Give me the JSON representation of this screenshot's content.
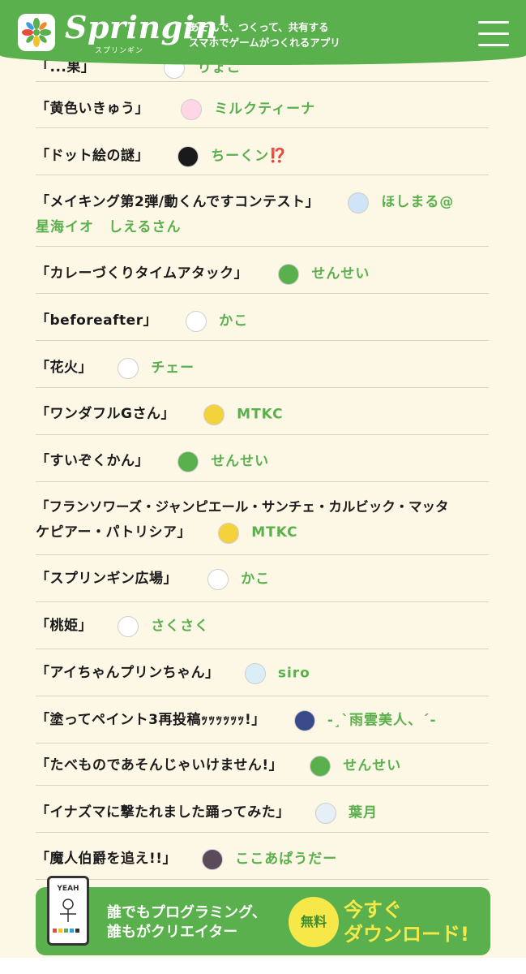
{
  "header": {
    "brand": "Springin'",
    "brand_kana": "スプリンギン",
    "tagline_1": "あそんで、つくって、共有する",
    "tagline_2": "スマホでゲームがつくれるアプリ"
  },
  "partial_row": {
    "title": "「...果」",
    "author": "りょこ"
  },
  "rows": [
    {
      "title": "「黄色いきゅう」",
      "author": "ミルクティーナ"
    },
    {
      "title": "「ドット絵の謎」",
      "author": "ちーくン",
      "suffix": "⁉️"
    },
    {
      "title": "「メイキング第2弾/動くんですコンテスト」",
      "author": "ほしまる@",
      "author_2": "星海イオ　しえるさん"
    },
    {
      "title": "「カレーづくりタイムアタック」",
      "author": "せんせい"
    },
    {
      "title": "「beforeafter」",
      "author": "かこ"
    },
    {
      "title": "「花火」",
      "author": "チェー"
    },
    {
      "title": "「ワンダフルGさん」",
      "author": "MTKC"
    },
    {
      "title": "「すいぞくかん」",
      "author": "せんせい"
    },
    {
      "title": "「フランソワーズ・ジャンピエール・サンチェ・カルビック・マッタ",
      "title_2": "ケピアー・パトリシア」",
      "author": "MTKC"
    },
    {
      "title": "「スプリンギン広場」",
      "author": "かこ"
    },
    {
      "title": "「桃姫」",
      "author": "さくさく"
    },
    {
      "title": "「アイちゃんプリンちゃん」",
      "author": "siro"
    },
    {
      "title": "「塗ってペイント3再投稿ｯｯｯｯｯｯ!」",
      "author": "-¸`雨雲美人、´-"
    },
    {
      "title": "「たべものであそんじゃいけません!」",
      "author": "せんせい"
    },
    {
      "title": "「イナズマに撃たれました踊ってみた」",
      "author": "葉月"
    },
    {
      "title": "「魔人伯爵を追え!!」",
      "author": "ここあぱうだー"
    }
  ],
  "cta": {
    "line1": "誰でもプログラミング、",
    "line2": "誰もがクリエイター",
    "badge": "無料",
    "dl1": "今すぐ",
    "dl2": "ダウンロード!",
    "phone_label": "YEAH"
  },
  "colors": {
    "brand_green": "#5ab04c",
    "background": "#fdf7e6",
    "badge_yellow": "#f7e84a"
  }
}
